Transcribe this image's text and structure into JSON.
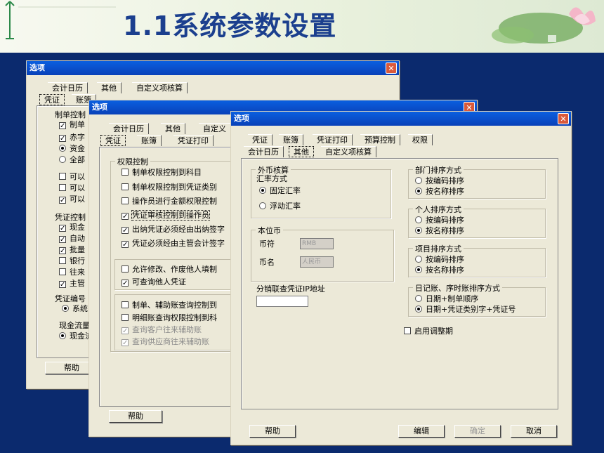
{
  "slide": {
    "title": "1.1系统参数设置"
  },
  "windows": {
    "w1": {
      "title": "选项",
      "tabs_back": [
        "会计日历",
        "其他",
        "自定义项核算"
      ],
      "tabs_front": [
        "凭证",
        "账簿"
      ],
      "rows": [
        {
          "type": "label",
          "text": "制单控制"
        },
        {
          "type": "check",
          "checked": true,
          "text": "制单"
        },
        {
          "type": "check",
          "checked": true,
          "text": "赤字"
        },
        {
          "type": "radio",
          "checked": true,
          "text": "资金"
        },
        {
          "type": "radio",
          "checked": false,
          "text": "全部"
        },
        {
          "type": "check",
          "checked": false,
          "text": "可以"
        },
        {
          "type": "check",
          "checked": false,
          "text": "可以"
        },
        {
          "type": "check",
          "checked": true,
          "text": "可以"
        },
        {
          "type": "label",
          "text": "凭证控制"
        },
        {
          "type": "check",
          "checked": true,
          "text": "现金"
        },
        {
          "type": "check",
          "checked": true,
          "text": "自动"
        },
        {
          "type": "check",
          "checked": true,
          "text": "批量"
        },
        {
          "type": "check",
          "checked": false,
          "text": "银行"
        },
        {
          "type": "check",
          "checked": false,
          "text": "往来"
        },
        {
          "type": "check",
          "checked": true,
          "text": "主管"
        },
        {
          "type": "label",
          "text": "凭证编号"
        },
        {
          "type": "radio",
          "checked": true,
          "text": "系统"
        },
        {
          "type": "label",
          "text": "现金流量"
        },
        {
          "type": "radio",
          "checked": true,
          "text": "现金流"
        }
      ],
      "help": "帮助"
    },
    "w2": {
      "title": "选项",
      "tabs_back": [
        "会计日历",
        "其他",
        "自定义"
      ],
      "tabs_front": [
        "凭证",
        "账簿",
        "凭证打印"
      ],
      "group_title": "权限控制",
      "rows": [
        {
          "checked": false,
          "disabled": false,
          "text": "制单权限控制到科目"
        },
        {
          "checked": false,
          "disabled": false,
          "text": "制单权限控制到凭证类别"
        },
        {
          "checked": false,
          "disabled": false,
          "text": "操作员进行金额权限控制"
        },
        {
          "checked": true,
          "disabled": false,
          "text": "凭证审核控制到操作员"
        },
        {
          "checked": true,
          "disabled": false,
          "text": "出纳凭证必须经由出纳签字"
        },
        {
          "checked": true,
          "disabled": false,
          "text": "凭证必须经由主管会计签字"
        },
        {
          "checked": false,
          "disabled": false,
          "text": "允许修改、作废他人填制"
        },
        {
          "checked": true,
          "disabled": false,
          "text": "可查询他人凭证"
        },
        {
          "checked": false,
          "disabled": false,
          "text": "制单、辅助账查询控制到"
        },
        {
          "checked": false,
          "disabled": false,
          "text": "明细账查询权限控制到科"
        },
        {
          "checked": true,
          "disabled": true,
          "text": "查询客户往来辅助账"
        },
        {
          "checked": true,
          "disabled": true,
          "text": "查询供应商往来辅助账"
        }
      ],
      "help": "帮助"
    },
    "w3": {
      "title": "选项",
      "tabs_back": [
        "凭证",
        "账簿",
        "凭证打印",
        "预算控制",
        "权限"
      ],
      "tabs_front": [
        "会计日历",
        "其他",
        "自定义项核算"
      ],
      "foreign": {
        "title": "外币核算",
        "rate_label": "汇率方式",
        "fixed": "固定汇率",
        "floating": "浮动汇率"
      },
      "base": {
        "title": "本位币",
        "code_label": "币符",
        "code_value": "RMB",
        "name_label": "币名",
        "name_value": "人民币"
      },
      "ip_label": "分销联查凭证IP地址",
      "ip_value": "",
      "sort_groups": [
        {
          "title": "部门排序方式",
          "opt1": "按编码排序",
          "opt2": "按名称排序"
        },
        {
          "title": "个人排序方式",
          "opt1": "按编码排序",
          "opt2": "按名称排序"
        },
        {
          "title": "项目排序方式",
          "opt1": "按编码排序",
          "opt2": "按名称排序"
        }
      ],
      "journal": {
        "title": "日记账、序时账排序方式",
        "opt1": "日期+制单顺序",
        "opt2": "日期+凭证类别字+凭证号"
      },
      "adjust_label": "启用调整期",
      "buttons": {
        "help": "帮助",
        "edit": "编辑",
        "ok": "确定",
        "cancel": "取消"
      }
    }
  },
  "colors": {
    "slide_bg": "#0b2a6e",
    "title_text": "#1b3f8e",
    "window_bg": "#ece9d8",
    "titlebar": "#0a5fe0"
  }
}
